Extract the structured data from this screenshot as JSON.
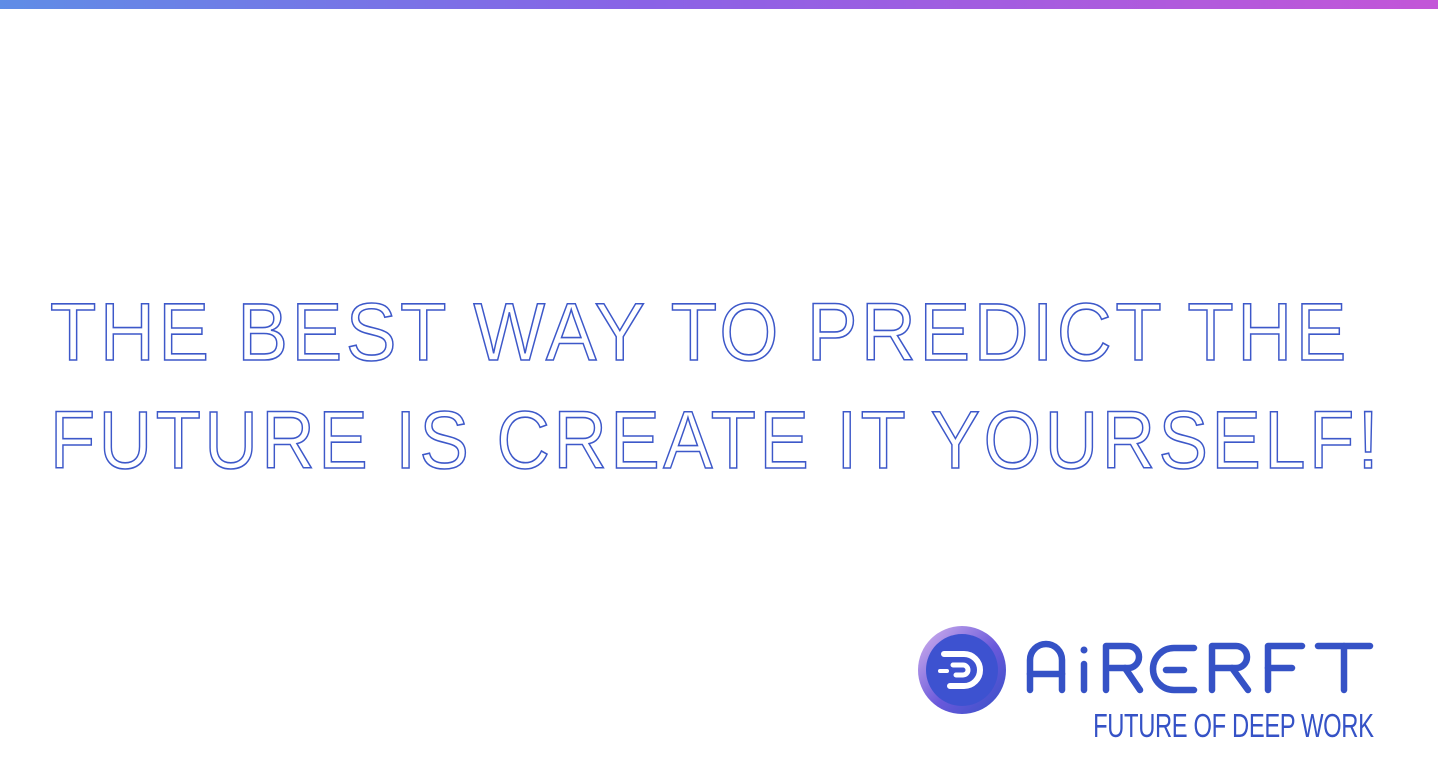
{
  "quote": {
    "line1": "THE BEST WAY TO PREDICT THE",
    "line2": "FUTURE IS CREATE IT YOURSELF!"
  },
  "brand": {
    "name": "AIRCRFT",
    "tagline": "FUTURE OF DEEP WORK",
    "logo_icon": "aircrft-d-logo-icon"
  },
  "colors": {
    "accent": "#3d58c9",
    "gradient_start": "#5f8de6",
    "gradient_end": "#c356d8",
    "background": "#ffffff"
  }
}
